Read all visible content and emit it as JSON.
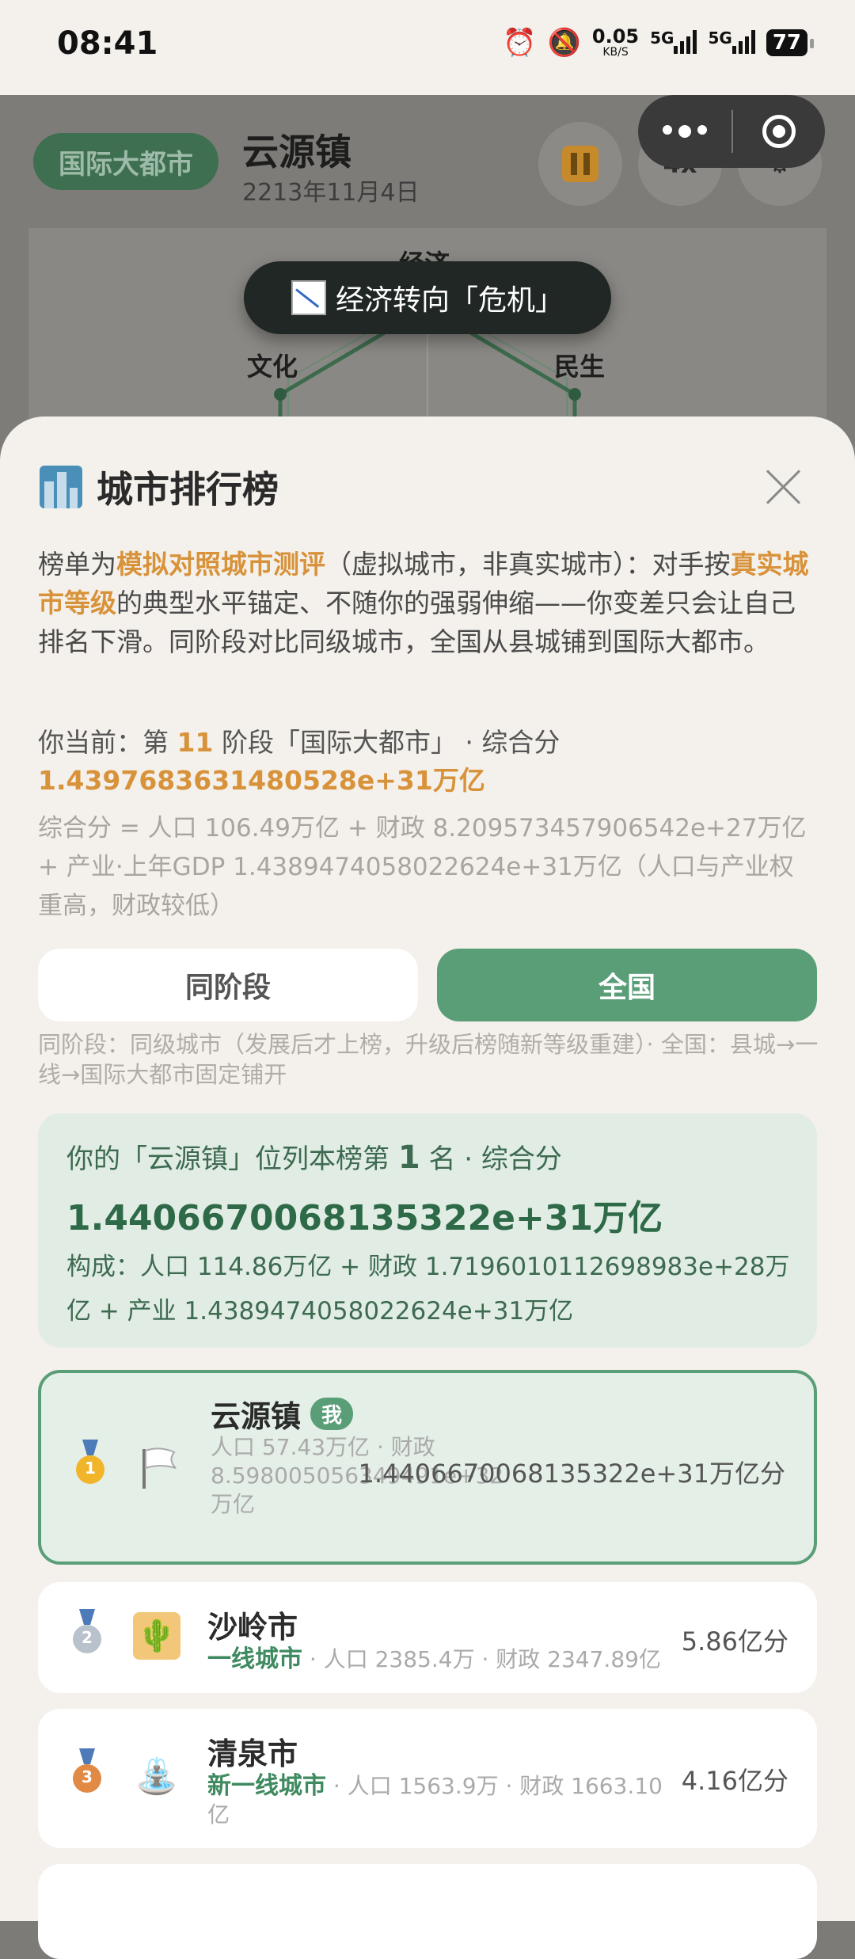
{
  "status": {
    "time": "08:41",
    "netspeed_value": "0.05",
    "netspeed_unit": "KB/S",
    "sig1": "5G",
    "sig2": "5G",
    "battery": "77"
  },
  "game": {
    "city_tier_badge": "国际大都市",
    "city_name": "云源镇",
    "date": "2213年11月4日",
    "speed": "4x",
    "radar_labels": {
      "top": "经济",
      "left": "文化",
      "right": "民生"
    }
  },
  "toast": {
    "text": "经济转向「危机」",
    "icon": "chart-decreasing-icon"
  },
  "sheet": {
    "title": "城市排行榜",
    "intro": {
      "p1": "榜单为",
      "h1": "模拟对照城市测评",
      "p2": "（虚拟城市，非真实城市）：对手按",
      "h2": "真实城市等级",
      "p3": "的典型水平锚定、不随你的强弱伸缩——你变差只会让自己排名下滑。同阶段对比同级城市，全国从县城铺到国际大都市。"
    },
    "current": {
      "prefix": "你当前：第",
      "stage": "11",
      "mid": "阶段「国际大都市」 · 综合分",
      "score": "1.439768363148052​8e+31万亿"
    },
    "formula": "综合分 = 人口 106.49万亿 + 财政 8.209573457906542e+27万亿 + 产业·上年GDP 1.4389474058022624e+31万亿（人口与产业权重高，财政较低）",
    "tabs": {
      "same_stage": "同阶段",
      "national": "全国"
    },
    "tab_note": "同阶段：同级城市（发展后才上榜，升级后榜随新等级重建）· 全国：县城→一线→国际大都市固定铺开",
    "my_rank": {
      "prefix": "你的「云源镇」位列本榜第",
      "rank": "1",
      "suffix": "名 · 综合分",
      "score": "1.4406670068135322e+31万亿",
      "composition": "构成：人口 114.86万亿 + 财政 1.7196010112698983e+28万亿 + 产业 1.4389474058022624e+31万亿"
    },
    "rows": [
      {
        "rank": "1",
        "name": "云源镇",
        "me_badge": "我",
        "tier": "",
        "meta": "人口 57.43万亿 · 财政 8.598005056349491e+32万亿",
        "score": "1.4406670068135322e+31万亿分",
        "avatar": "white-flag-icon"
      },
      {
        "rank": "2",
        "name": "沙岭市",
        "tier": "一线城市",
        "meta": " · 人口 2385.4万 · 财政 2347.89亿",
        "score": "5.86亿分",
        "avatar": "desert-cactus-icon"
      },
      {
        "rank": "3",
        "name": "清泉市",
        "tier": "新一线城市",
        "meta": " · 人口 1563.9万 · 财政 1663.10亿",
        "score": "4.16亿分",
        "avatar": "fountain-icon"
      }
    ]
  }
}
